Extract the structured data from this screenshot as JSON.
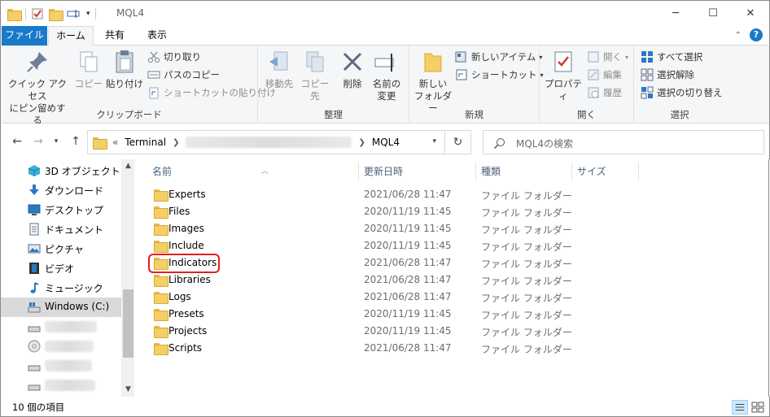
{
  "window": {
    "title": "MQL4",
    "minimize_glyph": "─",
    "maximize_glyph": "☐",
    "close_glyph": "✕"
  },
  "tabs": [
    {
      "label": "ファイル",
      "active": false,
      "primary": true
    },
    {
      "label": "ホーム",
      "active": true
    },
    {
      "label": "共有",
      "active": false
    },
    {
      "label": "表示",
      "active": false
    }
  ],
  "ribbon": {
    "clipboard": {
      "group_label": "クリップボード",
      "pin_quick_access": "クイック アクセス\nにピン留めする",
      "copy": "コピー",
      "paste": "貼り付け",
      "cut": "切り取り",
      "copy_path": "パスのコピー",
      "paste_shortcut": "ショートカットの貼り付け"
    },
    "organize": {
      "group_label": "整理",
      "move_to": "移動先",
      "copy_to": "コピー先",
      "delete": "削除",
      "rename": "名前の\n変更"
    },
    "new": {
      "group_label": "新規",
      "new_folder": "新しい\nフォルダー",
      "new_item": "新しいアイテム",
      "easy_access": "ショートカット"
    },
    "open": {
      "group_label": "開く",
      "properties": "プロパティ",
      "open": "開く",
      "edit": "編集",
      "history": "履歴"
    },
    "select": {
      "group_label": "選択",
      "select_all": "すべて選択",
      "select_none": "選択解除",
      "invert": "選択の切り替え"
    }
  },
  "address": {
    "overflow": "«",
    "crumbs": [
      "Terminal",
      "MQL4"
    ],
    "search_placeholder": "MQL4の検索"
  },
  "nav_pane": {
    "items": [
      {
        "label": "3D オブジェクト",
        "icon": "3d-objects-icon"
      },
      {
        "label": "ダウンロード",
        "icon": "downloads-icon"
      },
      {
        "label": "デスクトップ",
        "icon": "desktop-icon"
      },
      {
        "label": "ドキュメント",
        "icon": "documents-icon"
      },
      {
        "label": "ピクチャ",
        "icon": "pictures-icon"
      },
      {
        "label": "ビデオ",
        "icon": "videos-icon"
      },
      {
        "label": "ミュージック",
        "icon": "music-icon"
      },
      {
        "label": "Windows (C:)",
        "icon": "drive-icon",
        "selected": true
      }
    ]
  },
  "columns": {
    "name": "名前",
    "date": "更新日時",
    "type": "種類",
    "size": "サイズ"
  },
  "files": [
    {
      "name": "Experts",
      "date": "2021/06/28 11:47",
      "type": "ファイル フォルダー"
    },
    {
      "name": "Files",
      "date": "2020/11/19 11:45",
      "type": "ファイル フォルダー"
    },
    {
      "name": "Images",
      "date": "2020/11/19 11:45",
      "type": "ファイル フォルダー"
    },
    {
      "name": "Include",
      "date": "2020/11/19 11:45",
      "type": "ファイル フォルダー"
    },
    {
      "name": "Indicators",
      "date": "2021/06/28 11:47",
      "type": "ファイル フォルダー"
    },
    {
      "name": "Libraries",
      "date": "2021/06/28 11:47",
      "type": "ファイル フォルダー"
    },
    {
      "name": "Logs",
      "date": "2021/06/28 11:47",
      "type": "ファイル フォルダー"
    },
    {
      "name": "Presets",
      "date": "2020/11/19 11:45",
      "type": "ファイル フォルダー"
    },
    {
      "name": "Projects",
      "date": "2020/11/19 11:45",
      "type": "ファイル フォルダー"
    },
    {
      "name": "Scripts",
      "date": "2021/06/28 11:47",
      "type": "ファイル フォルダー"
    }
  ],
  "status": {
    "item_count": "10 個の項目"
  },
  "colors": {
    "accent": "#1979ca",
    "folder": "#f3cf66",
    "highlight": "#e02020"
  }
}
